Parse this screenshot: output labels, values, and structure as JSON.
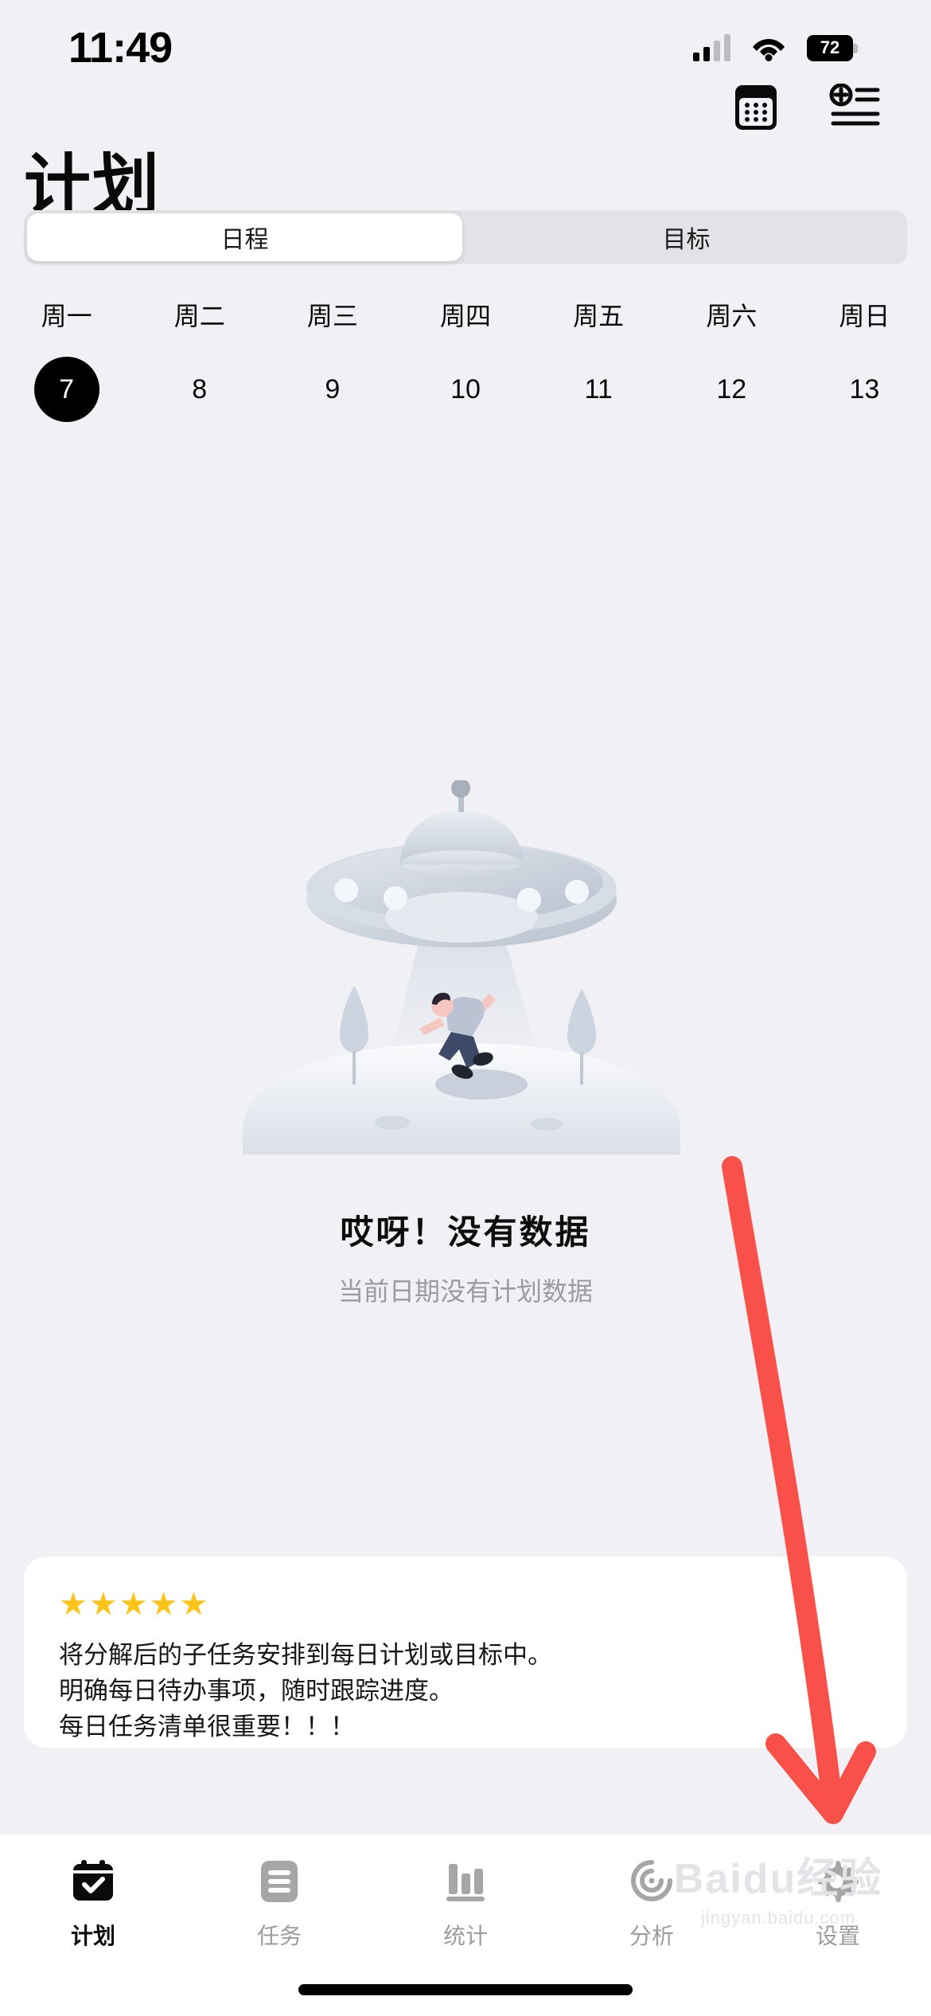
{
  "status_bar": {
    "time": "11:49",
    "battery_percent": "72",
    "wifi_icon": "wifi-icon",
    "signal_icon": "cellular-signal-icon"
  },
  "header": {
    "title": "计划",
    "calendar_button_icon": "calendar-icon",
    "add_list_button_icon": "add-list-icon"
  },
  "segmented_control": {
    "options": [
      {
        "label": "日程",
        "active": true
      },
      {
        "label": "目标",
        "active": false
      }
    ]
  },
  "week_strip": {
    "days": [
      {
        "name": "周一",
        "date": "7",
        "selected": true
      },
      {
        "name": "周二",
        "date": "8",
        "selected": false
      },
      {
        "name": "周三",
        "date": "9",
        "selected": false
      },
      {
        "name": "周四",
        "date": "10",
        "selected": false
      },
      {
        "name": "周五",
        "date": "11",
        "selected": false
      },
      {
        "name": "周六",
        "date": "12",
        "selected": false
      },
      {
        "name": "周日",
        "date": "13",
        "selected": false
      }
    ]
  },
  "empty_state": {
    "illustration": "ufo-abduction-illustration",
    "title": "哎呀！没有数据",
    "subtitle": "当前日期没有计划数据"
  },
  "tip_card": {
    "rating": "★★★★★",
    "star_color": "#FCC419",
    "lines": [
      "将分解后的子任务安排到每日计划或目标中。",
      "明确每日待办事项，随时跟踪进度。",
      "每日任务清单很重要！！！"
    ]
  },
  "annotation": {
    "arrow_color": "#F9504A",
    "points_to": "设置"
  },
  "tab_bar": {
    "tabs": [
      {
        "label": "计划",
        "icon": "calendar-check-icon",
        "active": true
      },
      {
        "label": "任务",
        "icon": "list-document-icon",
        "active": false
      },
      {
        "label": "统计",
        "icon": "bar-chart-icon",
        "active": false
      },
      {
        "label": "分析",
        "icon": "spiral-radar-icon",
        "active": false
      },
      {
        "label": "设置",
        "icon": "gear-icon",
        "active": false
      }
    ]
  },
  "watermark": {
    "main": "Baidu经验",
    "sub": "jingyan.baidu.com"
  }
}
